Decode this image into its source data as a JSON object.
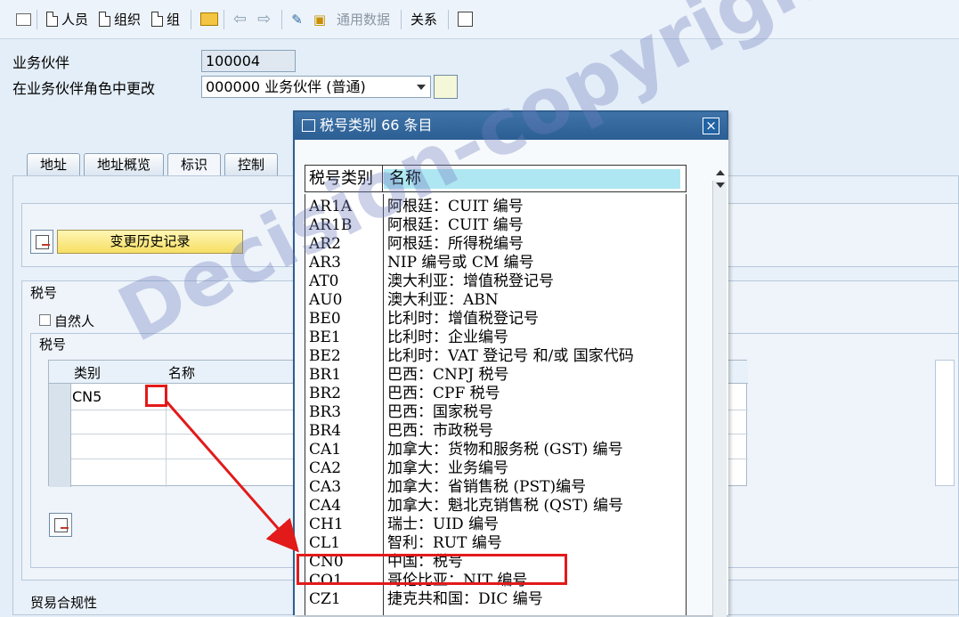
{
  "toolbar": {
    "items": {
      "person": "人员",
      "organization": "组织",
      "group": "组",
      "general_data": "通用数据",
      "relationships": "关系"
    }
  },
  "form": {
    "business_partner_label": "业务伙伴",
    "business_partner_value": "100004",
    "role_label": "在业务伙伴角色中更改",
    "role_value": "000000 业务伙伴 (普通)"
  },
  "tabs": [
    "地址",
    "地址概览",
    "标识",
    "控制"
  ],
  "sections": {
    "history_button": "变更历史记录",
    "tax_number_section": "税号",
    "natural_person_label": "自然人",
    "tax_number_group": "税号",
    "trade_compliance": "贸易合规性"
  },
  "tax_table": {
    "headers": [
      "类别",
      "名称"
    ],
    "rows": [
      {
        "category": "CN5",
        "name": ""
      }
    ]
  },
  "popup": {
    "title": "税号类别  66 条目",
    "headers": [
      "税号类别",
      "名称"
    ],
    "rows": [
      {
        "code": "AR1A",
        "name": "阿根廷：CUIT 编号"
      },
      {
        "code": "AR1B",
        "name": "阿根廷：CUIT 编号"
      },
      {
        "code": "AR2",
        "name": "阿根廷：所得税编号"
      },
      {
        "code": "AR3",
        "name": "NIP 编号或 CM 编号"
      },
      {
        "code": "AT0",
        "name": "澳大利亚：增值税登记号"
      },
      {
        "code": "AU0",
        "name": "澳大利亚：ABN"
      },
      {
        "code": "BE0",
        "name": "比利时：增值税登记号"
      },
      {
        "code": "BE1",
        "name": "比利时：企业编号"
      },
      {
        "code": "BE2",
        "name": "比利时：VAT 登记号 和/或 国家代码"
      },
      {
        "code": "BR1",
        "name": "巴西：CNPJ 税号"
      },
      {
        "code": "BR2",
        "name": "巴西：CPF 税号"
      },
      {
        "code": "BR3",
        "name": "巴西：国家税号"
      },
      {
        "code": "BR4",
        "name": "巴西：市政税号"
      },
      {
        "code": "CA1",
        "name": "加拿大：货物和服务税 (GST) 编号"
      },
      {
        "code": "CA2",
        "name": "加拿大：业务编号"
      },
      {
        "code": "CA3",
        "name": "加拿大：省销售税 (PST)编号"
      },
      {
        "code": "CA4",
        "name": "加拿大：魁北克销售税 (QST) 编号"
      },
      {
        "code": "CH1",
        "name": "瑞士：UID 编号"
      },
      {
        "code": "CL1",
        "name": "智利：RUT 编号"
      },
      {
        "code": "CN0",
        "name": "中国：税号"
      },
      {
        "code": "CO1",
        "name": "哥伦比亚：NIT 编号"
      },
      {
        "code": "CZ1",
        "name": "捷克共和国：DIC 编号"
      }
    ]
  },
  "watermark": "Decision-copyright",
  "colors": {
    "highlight": "#e21a1a",
    "popup_title": "#2b5f94",
    "header_cyan": "#aee7f2"
  }
}
